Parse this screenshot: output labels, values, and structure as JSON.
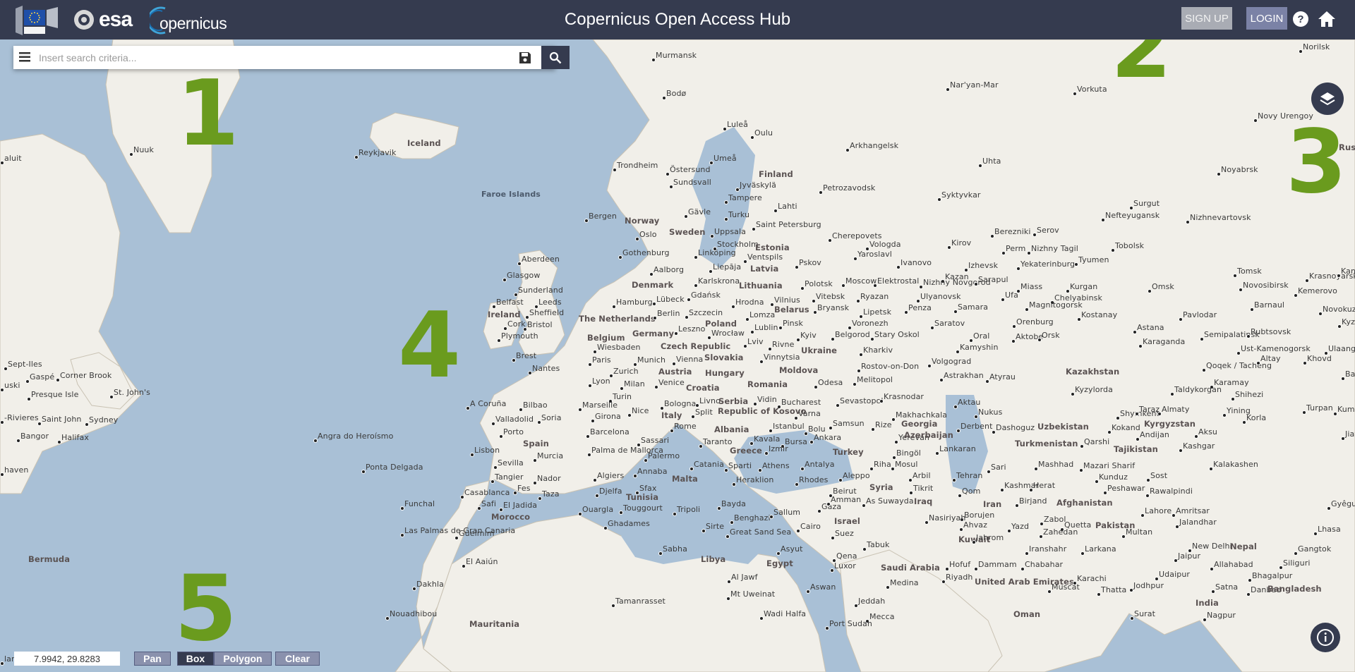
{
  "header": {
    "title": "Copernicus Open Access Hub",
    "esa_logo_text": "esa",
    "copernicus_logo_text": "opernicus",
    "eu_logo_text": "European Commission",
    "signup_label": "SIGN UP",
    "login_label": "LOGIN"
  },
  "search": {
    "placeholder": "Insert search criteria..."
  },
  "callouts": [
    "1",
    "2",
    "3",
    "4",
    "5"
  ],
  "map": {
    "places": [
      {
        "name": "Nuuk"
      },
      {
        "name": "Reykjavik"
      },
      {
        "name": "Iceland"
      },
      {
        "name": "Faroe Islands"
      },
      {
        "name": "Murmansk"
      },
      {
        "name": "Nar'yan-Mar"
      },
      {
        "name": "Vorkuta"
      },
      {
        "name": "Norilsk"
      },
      {
        "name": "Bodø"
      },
      {
        "name": "Luleå"
      },
      {
        "name": "Oulu"
      },
      {
        "name": "Arkhangelsk"
      },
      {
        "name": "Novy Urengoy"
      },
      {
        "name": "Trondheim"
      },
      {
        "name": "Östersund"
      },
      {
        "name": "Umeå"
      },
      {
        "name": "Finland"
      },
      {
        "name": "Uhta"
      },
      {
        "name": "Noyabrsk"
      },
      {
        "name": "Sundsvall"
      },
      {
        "name": "Jyväskylä"
      },
      {
        "name": "Petrozavodsk"
      },
      {
        "name": "Syktyvkar"
      },
      {
        "name": "Tampere"
      },
      {
        "name": "Lahti"
      },
      {
        "name": "Surgut"
      },
      {
        "name": "Bergen"
      },
      {
        "name": "Gävle"
      },
      {
        "name": "Turku"
      },
      {
        "name": "Nefteyugansk"
      },
      {
        "name": "Nizhnevartovsk"
      },
      {
        "name": "Norway"
      },
      {
        "name": "Uppsala"
      },
      {
        "name": "Saint Petersburg"
      },
      {
        "name": "Oslo"
      },
      {
        "name": "Sweden"
      },
      {
        "name": "Stockholm"
      },
      {
        "name": "Cherepovets"
      },
      {
        "name": "Vologda"
      },
      {
        "name": "Berezniki"
      },
      {
        "name": "Serov"
      },
      {
        "name": "Estonia"
      },
      {
        "name": "Kirov"
      },
      {
        "name": "Perm"
      },
      {
        "name": "Nizhny Tagil"
      },
      {
        "name": "Tobolsk"
      },
      {
        "name": "Aberdeen"
      },
      {
        "name": "Gothenburg"
      },
      {
        "name": "Linköping"
      },
      {
        "name": "Ventspils"
      },
      {
        "name": "Pskov"
      },
      {
        "name": "Yaroslavl"
      },
      {
        "name": "Ivanovo"
      },
      {
        "name": "Izhevsk"
      },
      {
        "name": "Yekaterinburg"
      },
      {
        "name": "Tyumen"
      },
      {
        "name": "Aalborg"
      },
      {
        "name": "Liepāja"
      },
      {
        "name": "Latvia"
      },
      {
        "name": "Kazan"
      },
      {
        "name": "Tomsk"
      },
      {
        "name": "Krasnoyarsk"
      },
      {
        "name": "Kansk"
      },
      {
        "name": "Glasgow"
      },
      {
        "name": "Karlskrona"
      },
      {
        "name": "Polotsk"
      },
      {
        "name": "Moscow"
      },
      {
        "name": "Elektrostal"
      },
      {
        "name": "Nizhny Novgorod"
      },
      {
        "name": "Sarapul"
      },
      {
        "name": "Miass"
      },
      {
        "name": "Kurgan"
      },
      {
        "name": "Denmark"
      },
      {
        "name": "Lithuania"
      },
      {
        "name": "Vitebsk"
      },
      {
        "name": "Ryazan"
      },
      {
        "name": "Ufa"
      },
      {
        "name": "Omsk"
      },
      {
        "name": "Novosibirsk"
      },
      {
        "name": "Sunderland"
      },
      {
        "name": "Belfast"
      },
      {
        "name": "Leeds"
      },
      {
        "name": "Gdańsk"
      },
      {
        "name": "Vilnius"
      },
      {
        "name": "Chelyabinsk"
      },
      {
        "name": "Kemerovo"
      },
      {
        "name": "Ireland"
      },
      {
        "name": "Sheffield"
      },
      {
        "name": "The Netherlands"
      },
      {
        "name": "Hamburg"
      },
      {
        "name": "Lübeck"
      },
      {
        "name": "Hrodna"
      },
      {
        "name": "Ulyanovsk"
      },
      {
        "name": "Barnaul"
      },
      {
        "name": "Novokuznetsk"
      },
      {
        "name": "Cork"
      },
      {
        "name": "Bristol"
      },
      {
        "name": "Berlin"
      },
      {
        "name": "Szczecin"
      },
      {
        "name": "Belarus"
      },
      {
        "name": "Bryansk"
      },
      {
        "name": "Penza"
      },
      {
        "name": "Samara"
      },
      {
        "name": "Magnitogorsk"
      },
      {
        "name": "Kostanay"
      },
      {
        "name": "Pavlodar"
      },
      {
        "name": "Poland"
      },
      {
        "name": "Lomza"
      },
      {
        "name": "Lipetsk"
      },
      {
        "name": "Orenburg"
      },
      {
        "name": "Plymouth"
      },
      {
        "name": "Belgium"
      },
      {
        "name": "Germany"
      },
      {
        "name": "Leszno"
      },
      {
        "name": "Wrocław"
      },
      {
        "name": "Lublin"
      },
      {
        "name": "Pinsk"
      },
      {
        "name": "Voronezh"
      },
      {
        "name": "Saratov"
      },
      {
        "name": "Astana"
      },
      {
        "name": "Semipalatinsk"
      },
      {
        "name": "Rubtsovsk"
      },
      {
        "name": "Kyzyl"
      },
      {
        "name": "Wiesbaden"
      },
      {
        "name": "Kyiv"
      },
      {
        "name": "Belgorod"
      },
      {
        "name": "Stary Oskol"
      },
      {
        "name": "Oral"
      },
      {
        "name": "Aktobe"
      },
      {
        "name": "Orsk"
      },
      {
        "name": "Karaganda"
      },
      {
        "name": "Ust-Kamenogorsk"
      },
      {
        "name": "Ulaangom"
      },
      {
        "name": "Czech Republic"
      },
      {
        "name": "Lviv"
      },
      {
        "name": "Rivne"
      },
      {
        "name": "Kharkiv"
      },
      {
        "name": "Kamyshin"
      },
      {
        "name": "Brest"
      },
      {
        "name": "Paris"
      },
      {
        "name": "Munich"
      },
      {
        "name": "Vienna"
      },
      {
        "name": "Slovakia"
      },
      {
        "name": "Vinnytsia"
      },
      {
        "name": "Ukraine"
      },
      {
        "name": "Volgograd"
      },
      {
        "name": "Khovd"
      },
      {
        "name": "Nantes"
      },
      {
        "name": "Zurich"
      },
      {
        "name": "Austria"
      },
      {
        "name": "Hungary"
      },
      {
        "name": "Moldova"
      },
      {
        "name": "Rostov-on-Don"
      },
      {
        "name": "Kazakhstan"
      },
      {
        "name": "Qoqek / Tacheng"
      },
      {
        "name": "Altay"
      },
      {
        "name": "Bayankhongor"
      },
      {
        "name": "Lyon"
      },
      {
        "name": "Milan"
      },
      {
        "name": "Venice"
      },
      {
        "name": "Romania"
      },
      {
        "name": "Odesa"
      },
      {
        "name": "Melitopol"
      },
      {
        "name": "Astrakhan"
      },
      {
        "name": "Atyrau"
      },
      {
        "name": "Karamay"
      },
      {
        "name": "Turin"
      },
      {
        "name": "Croatia"
      },
      {
        "name": "Kyzylorda"
      },
      {
        "name": "Taldykorgan"
      },
      {
        "name": "Shihezi"
      },
      {
        "name": "A Coruña"
      },
      {
        "name": "Bilbao"
      },
      {
        "name": "Marseille"
      },
      {
        "name": "Bologna"
      },
      {
        "name": "Livno"
      },
      {
        "name": "Serbia"
      },
      {
        "name": "Vidin"
      },
      {
        "name": "Bucharest"
      },
      {
        "name": "Sevastopol"
      },
      {
        "name": "Krasnodar"
      },
      {
        "name": "Aktau"
      },
      {
        "name": "Turpan"
      },
      {
        "name": "Valladolid"
      },
      {
        "name": "Soria"
      },
      {
        "name": "Girona"
      },
      {
        "name": "Nice"
      },
      {
        "name": "Split"
      },
      {
        "name": "Republic of Kosovo"
      },
      {
        "name": "Varna"
      },
      {
        "name": "Makhachkala"
      },
      {
        "name": "Nukus"
      },
      {
        "name": "Shymkent"
      },
      {
        "name": "Taraz"
      },
      {
        "name": "Almaty"
      },
      {
        "name": "Yining"
      },
      {
        "name": "Kumul"
      },
      {
        "name": "Porto"
      },
      {
        "name": "Italy"
      },
      {
        "name": "Rome"
      },
      {
        "name": "Albania"
      },
      {
        "name": "Istanbul"
      },
      {
        "name": "Bolu"
      },
      {
        "name": "Samsun"
      },
      {
        "name": "Rize"
      },
      {
        "name": "Georgia"
      },
      {
        "name": "Derbent"
      },
      {
        "name": "Dashoguz"
      },
      {
        "name": "Uzbekistan"
      },
      {
        "name": "Kokand"
      },
      {
        "name": "Kyrgyzstan"
      },
      {
        "name": "Korla"
      },
      {
        "name": "Barcelona"
      },
      {
        "name": "Kavala"
      },
      {
        "name": "Ankara"
      },
      {
        "name": "Yerevan"
      },
      {
        "name": "Azerbaijan"
      },
      {
        "name": "Andijan"
      },
      {
        "name": "Aksu"
      },
      {
        "name": "Jiayuguan"
      },
      {
        "name": "Angra do Heroísmo"
      },
      {
        "name": "Spain"
      },
      {
        "name": "Sassari"
      },
      {
        "name": "Taranto"
      },
      {
        "name": "Bursa"
      },
      {
        "name": "Turkmenistan"
      },
      {
        "name": "Qarshi"
      },
      {
        "name": "Lisbon"
      },
      {
        "name": "Murcia"
      },
      {
        "name": "Palma de Mallorca"
      },
      {
        "name": "Palermo"
      },
      {
        "name": "Greece"
      },
      {
        "name": "Izmir"
      },
      {
        "name": "Turkey"
      },
      {
        "name": "Bingöl"
      },
      {
        "name": "Lankaran"
      },
      {
        "name": "Tajikistan"
      },
      {
        "name": "Kashgar"
      },
      {
        "name": "Sevilla"
      },
      {
        "name": "Catania"
      },
      {
        "name": "Sparti"
      },
      {
        "name": "Athens"
      },
      {
        "name": "Antalya"
      },
      {
        "name": "Riha"
      },
      {
        "name": "Mosul"
      },
      {
        "name": "Ponta Delgada"
      },
      {
        "name": "Tangier"
      },
      {
        "name": "Nador"
      },
      {
        "name": "Algiers"
      },
      {
        "name": "Annaba"
      },
      {
        "name": "Malta"
      },
      {
        "name": "Heraklion"
      },
      {
        "name": "Rhodes"
      },
      {
        "name": "Aleppo"
      },
      {
        "name": "Syria"
      },
      {
        "name": "Arbil"
      },
      {
        "name": "Tehran"
      },
      {
        "name": "Sari"
      },
      {
        "name": "Mashhad"
      },
      {
        "name": "Mazari Sharif"
      },
      {
        "name": "Kunduz"
      },
      {
        "name": "Sost"
      },
      {
        "name": "Kalakashen"
      },
      {
        "name": "Casablanca"
      },
      {
        "name": "Fes"
      },
      {
        "name": "Taza"
      },
      {
        "name": "Djelfa"
      },
      {
        "name": "Sfax"
      },
      {
        "name": "Tunisia"
      },
      {
        "name": "Beirut"
      },
      {
        "name": "Tikrit"
      },
      {
        "name": "Qom"
      },
      {
        "name": "Kashmar"
      },
      {
        "name": "Herat"
      },
      {
        "name": "Peshawar"
      },
      {
        "name": "Rawalpindi"
      },
      {
        "name": "Funchal"
      },
      {
        "name": "Safi"
      },
      {
        "name": "El Jadida"
      },
      {
        "name": "Touggourt"
      },
      {
        "name": "Tripoli"
      },
      {
        "name": "Bayda"
      },
      {
        "name": "Gaza"
      },
      {
        "name": "Amman"
      },
      {
        "name": "As Suwayda"
      },
      {
        "name": "Iraq"
      },
      {
        "name": "Iran"
      },
      {
        "name": "Birjand"
      },
      {
        "name": "Afghanistan"
      },
      {
        "name": "Gyêgu"
      },
      {
        "name": "Morocco"
      },
      {
        "name": "Ouargla"
      },
      {
        "name": "Benghazi"
      },
      {
        "name": "Sallum"
      },
      {
        "name": "Borujen"
      },
      {
        "name": "Lahore"
      },
      {
        "name": "Amritsar"
      },
      {
        "name": "Ghadames"
      },
      {
        "name": "Sirte"
      },
      {
        "name": "Cairo"
      },
      {
        "name": "Israel"
      },
      {
        "name": "Nasiriyah"
      },
      {
        "name": "Ahvaz"
      },
      {
        "name": "Yazd"
      },
      {
        "name": "Zabol"
      },
      {
        "name": "Quetta"
      },
      {
        "name": "Pakistan"
      },
      {
        "name": "Jalandhar"
      },
      {
        "name": "Las Palmas de Gran Canaria"
      },
      {
        "name": "Guelmim"
      },
      {
        "name": "Great Sand Sea"
      },
      {
        "name": "Suez"
      },
      {
        "name": "Tabuk"
      },
      {
        "name": "Kuwait"
      },
      {
        "name": "Jahrom"
      },
      {
        "name": "Zahedan"
      },
      {
        "name": "Multan"
      },
      {
        "name": "New Delhi"
      },
      {
        "name": "Lhasa"
      },
      {
        "name": "Sabha"
      },
      {
        "name": "Asyut"
      },
      {
        "name": "Qena"
      },
      {
        "name": "Iranshahr"
      },
      {
        "name": "Larkana"
      },
      {
        "name": "Jaipur"
      },
      {
        "name": "Nepal"
      },
      {
        "name": "Gangtok"
      },
      {
        "name": "El Aaiún"
      },
      {
        "name": "Libya"
      },
      {
        "name": "Egypt"
      },
      {
        "name": "Luxor"
      },
      {
        "name": "Saudi Arabia"
      },
      {
        "name": "Hofuf"
      },
      {
        "name": "Dammam"
      },
      {
        "name": "Chabahar"
      },
      {
        "name": "Allahabad"
      },
      {
        "name": "Siliguri"
      },
      {
        "name": "Al Jawf"
      },
      {
        "name": "Riyadh"
      },
      {
        "name": "United Arab Emirates"
      },
      {
        "name": "Karachi"
      },
      {
        "name": "Udaipur"
      },
      {
        "name": "Bhagalpur"
      },
      {
        "name": "Dakhla"
      },
      {
        "name": "Medina"
      },
      {
        "name": "Muscat"
      },
      {
        "name": "Danbad"
      },
      {
        "name": "Mt Uweinat"
      },
      {
        "name": "Aswan"
      },
      {
        "name": "Thatta"
      },
      {
        "name": "Jodhpur"
      },
      {
        "name": "Satna"
      },
      {
        "name": "Bangladesh"
      },
      {
        "name": "Tamanrasset"
      },
      {
        "name": "Jeddah"
      },
      {
        "name": "India"
      },
      {
        "name": "Nouadhibou"
      },
      {
        "name": "Wadi Halfa"
      },
      {
        "name": "Mecca"
      },
      {
        "name": "Oman"
      },
      {
        "name": "Surat"
      },
      {
        "name": "Nagpur"
      },
      {
        "name": "Mauritania"
      },
      {
        "name": "Port Sudan"
      },
      {
        "name": "Bermuda"
      },
      {
        "name": "Sept-Iles"
      },
      {
        "name": "Gaspé"
      },
      {
        "name": "Corner Brook"
      },
      {
        "name": "Presque Isle"
      },
      {
        "name": "St. John's"
      },
      {
        "name": "Saint John"
      },
      {
        "name": "Sydney"
      },
      {
        "name": "Bangor"
      },
      {
        "name": "Halifax"
      },
      {
        "name": "-Rivieres"
      },
      {
        "name": "haven"
      },
      {
        "name": "aluit"
      },
      {
        "name": "Rus"
      },
      {
        "name": "uski"
      },
      {
        "name": "land"
      }
    ]
  },
  "toolbar": {
    "coordinates": "7.9942, 29.8283",
    "pan_label": "Pan",
    "box_label": "Box",
    "polygon_label": "Polygon",
    "clear_label": "Clear",
    "active_tool": "Box"
  },
  "colors": {
    "header_bg": "#353b4f",
    "callout_green": "#6a9b1e",
    "sea": "#a9c0d6",
    "land": "#f1efe9"
  },
  "icons": [
    "menu-icon",
    "save-icon",
    "search-icon",
    "layers-icon",
    "help-icon",
    "home-icon",
    "info-icon"
  ]
}
